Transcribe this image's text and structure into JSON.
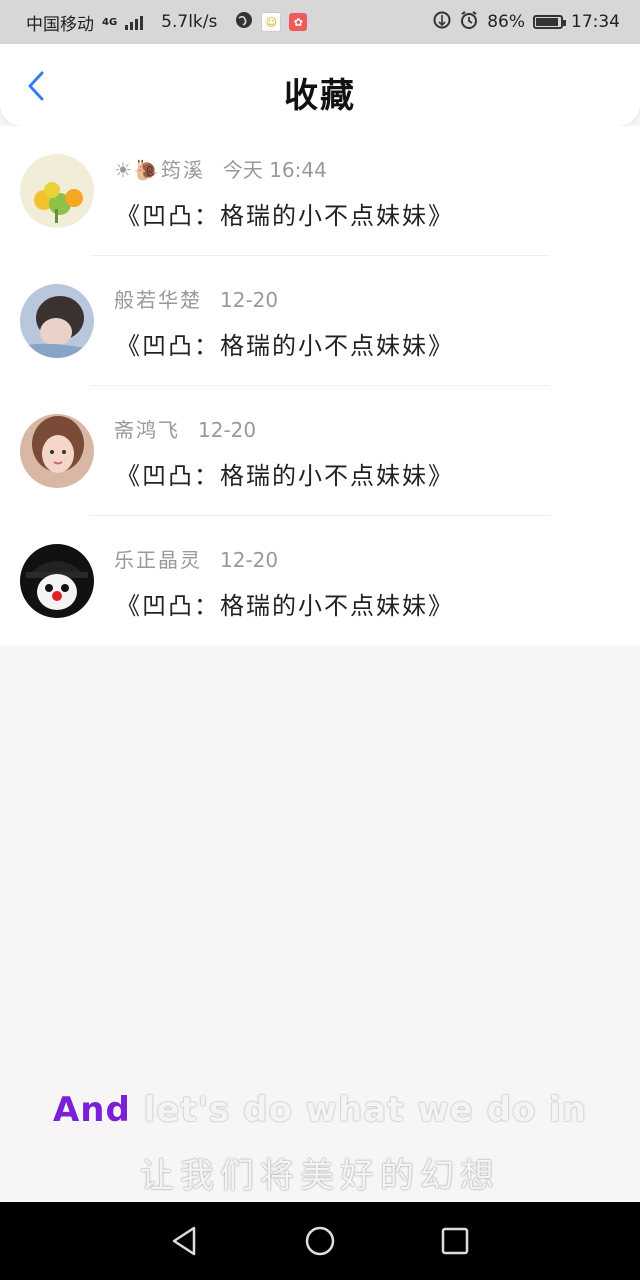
{
  "status_bar": {
    "carrier": "中国移动",
    "network": "4G",
    "speed": "5.7lk/s",
    "battery": "86%",
    "battery_level": 0.86,
    "time": "17:34",
    "icons": [
      "signal-icon",
      "globe-icon",
      "app-badge-icon",
      "app-badge-icon",
      "data-icon",
      "alarm-icon",
      "battery-icon"
    ]
  },
  "nav": {
    "title": "收藏",
    "back_icon": "chevron-left-icon",
    "accent": "#2f80ed"
  },
  "favorites": [
    {
      "name": "☀🐌筠溪",
      "time": "今天 16:44",
      "content": "《凹凸：格瑞的小不点妹妹》"
    },
    {
      "name": "般若华楚",
      "time": "12-20",
      "content": "《凹凸：格瑞的小不点妹妹》"
    },
    {
      "name": "斋鸿飞",
      "time": "12-20",
      "content": "《凹凸：格瑞的小不点妹妹》"
    },
    {
      "name": "乐正晶灵",
      "time": "12-20",
      "content": "《凹凸：格瑞的小不点妹妹》"
    }
  ],
  "lyrics": {
    "line1_highlight": "And",
    "line1_rest": " let's do what we do in",
    "line2": "让我们将美好的幻想",
    "highlight_color": "#7a20d6"
  },
  "system_nav": {
    "back_icon": "triangle-back-icon",
    "home_icon": "circle-home-icon",
    "recents_icon": "square-recents-icon"
  }
}
